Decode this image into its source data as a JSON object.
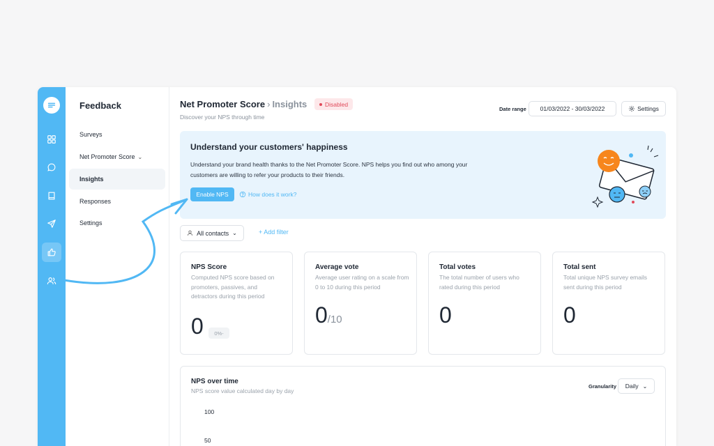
{
  "sidebar": {
    "title": "Feedback",
    "items": [
      {
        "label": "Surveys"
      },
      {
        "label": "Net Promoter Score"
      },
      {
        "label": "Insights"
      },
      {
        "label": "Responses"
      },
      {
        "label": "Settings"
      }
    ]
  },
  "rail": {
    "icons": [
      "chat-logo-icon",
      "grid-icon",
      "chat-icon",
      "book-icon",
      "send-icon",
      "thumbs-up-icon",
      "users-icon"
    ],
    "active": "thumbs-up-icon",
    "accent": "#51b8f4"
  },
  "header": {
    "title": "Net Promoter Score",
    "breadcrumb": "Insights",
    "status": "Disabled",
    "subtitle": "Discover your NPS through time",
    "date_range_label": "Date range",
    "date_range_value": "01/03/2022 - 30/03/2022",
    "settings_label": "Settings"
  },
  "banner": {
    "title": "Understand your customers' happiness",
    "text": "Understand your brand health thanks to the Net Promoter Score. NPS helps you find out who among your customers are willing to refer your products to their friends.",
    "enable_label": "Enable NPS",
    "how_label": "How does it work?"
  },
  "filters": {
    "contacts_label": "All contacts",
    "add_filter_label": "+ Add filter"
  },
  "cards": [
    {
      "title": "NPS Score",
      "desc": "Computed NPS score based on promoters, passives, and detractors during this period",
      "value": "0",
      "pct": "0%-"
    },
    {
      "title": "Average vote",
      "desc": "Average user rating on a scale from 0 to 10 during this period",
      "value": "0",
      "suffix": "/10"
    },
    {
      "title": "Total votes",
      "desc": "The total number of users who rated during this period",
      "value": "0"
    },
    {
      "title": "Total sent",
      "desc": "Total unique NPS survey emails sent during this period",
      "value": "0"
    }
  ],
  "chart": {
    "title": "NPS over time",
    "subtitle": "NPS score value calculated day by day",
    "granularity_label": "Granularity",
    "granularity_value": "Daily",
    "yticks": [
      "100",
      "50"
    ]
  }
}
